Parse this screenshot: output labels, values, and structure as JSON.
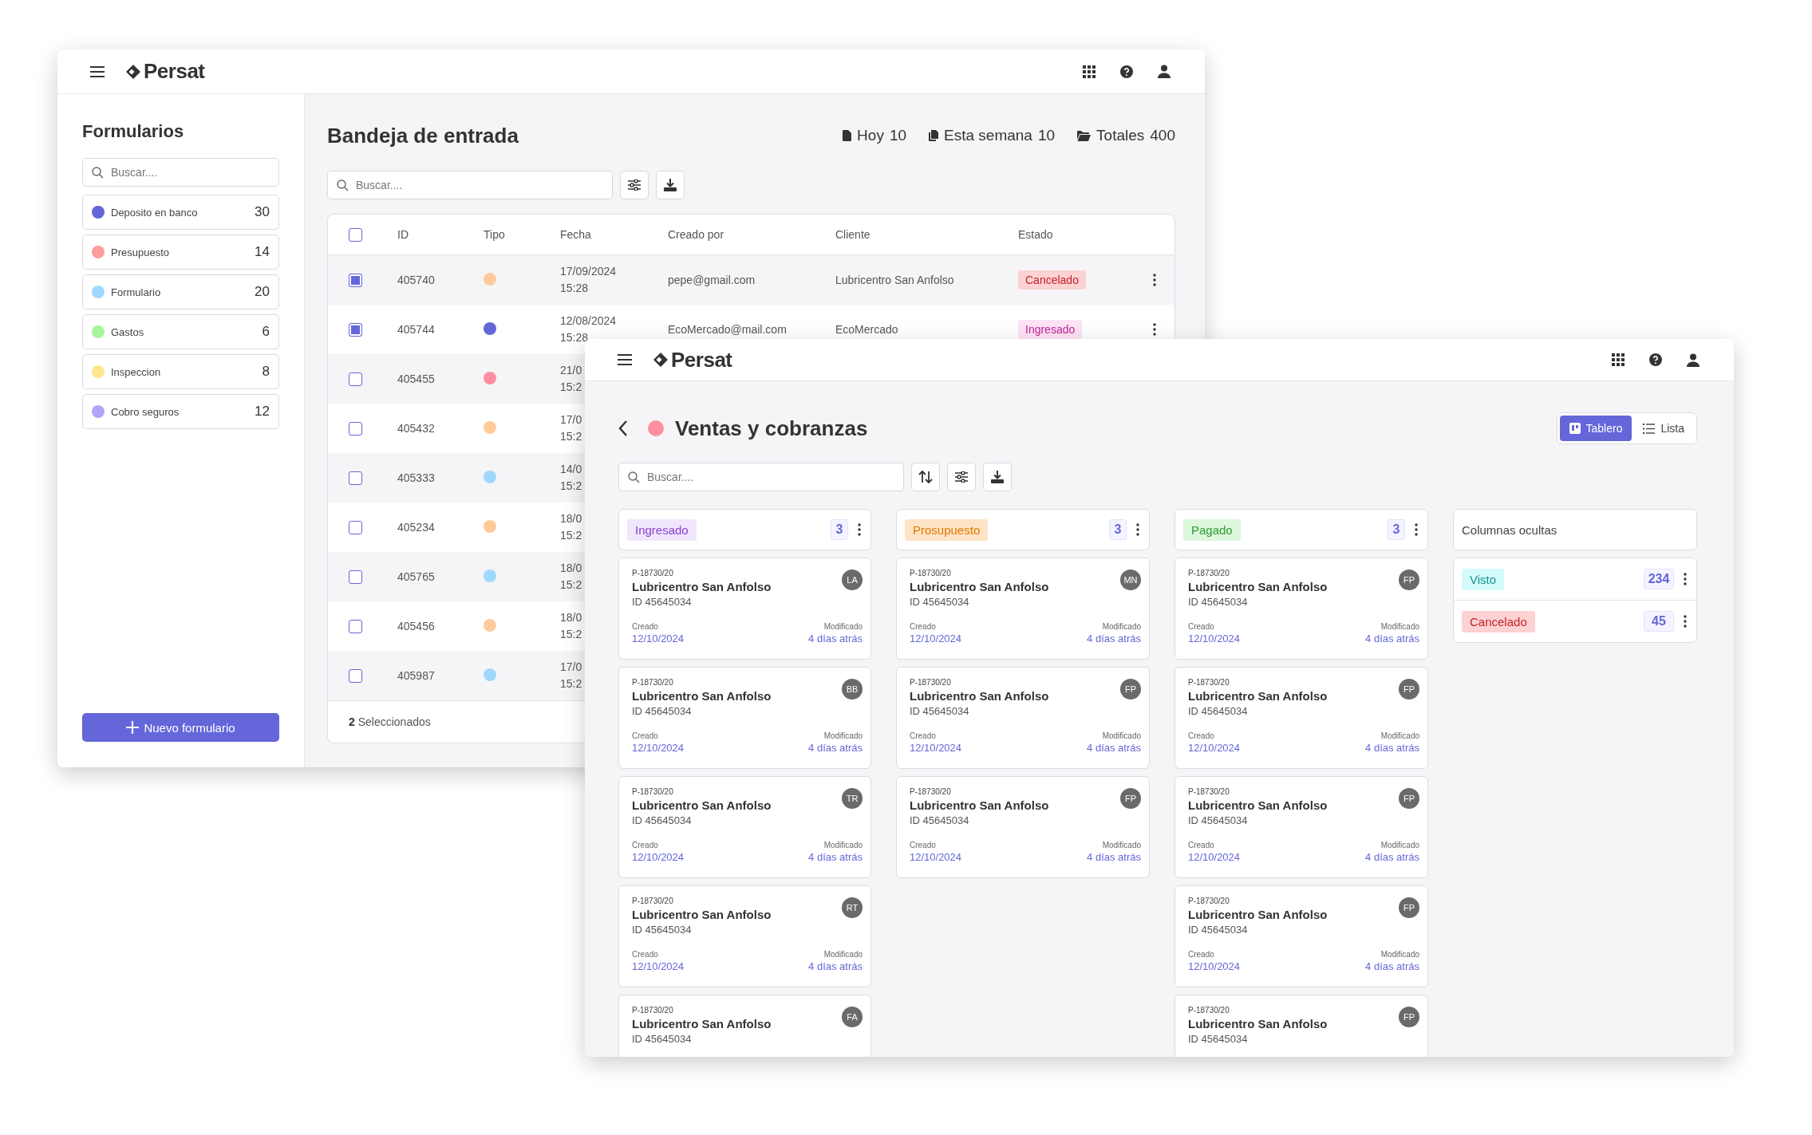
{
  "inbox": {
    "logo": "Persat",
    "sidebar": {
      "title": "Formularios",
      "search": {
        "placeholder": "Buscar...."
      },
      "items": [
        {
          "label": "Deposito en banco",
          "count": "30",
          "color": "#6466d9"
        },
        {
          "label": "Presupuesto",
          "count": "14",
          "color": "#ff9b9b"
        },
        {
          "label": "Formulario",
          "count": "20",
          "color": "#9fd8ff"
        },
        {
          "label": "Gastos",
          "count": "6",
          "color": "#a6f59b"
        },
        {
          "label": "Inspeccion",
          "count": "8",
          "color": "#ffe590"
        },
        {
          "label": "Cobro seguros",
          "count": "12",
          "color": "#b5a3f8"
        }
      ],
      "button": "Nuevo formulario"
    },
    "main": {
      "title": "Bandeja de entrada",
      "stats": [
        {
          "kind": "file",
          "label": "Hoy",
          "value": "10"
        },
        {
          "kind": "files",
          "label": "Esta semana",
          "value": "10"
        },
        {
          "kind": "folder",
          "label": "Totales",
          "value": "400"
        }
      ],
      "search": {
        "placeholder": "Buscar...."
      },
      "table": {
        "header_checked": false,
        "columns": [
          "ID",
          "Tipo",
          "Fecha",
          "Creado por",
          "Cliente",
          "Estado"
        ],
        "rows": [
          {
            "checked": true,
            "id": "405740",
            "color": "#ffcb9a",
            "date": "17/09/2024",
            "time": "15:28",
            "created_by": "pepe@gmail.com",
            "client": "Lubricentro San Anfolso",
            "status": {
              "label": "Cancelado",
              "kind": "cancelado"
            }
          },
          {
            "checked": true,
            "id": "405744",
            "color": "#6466d9",
            "date": "12/08/2024",
            "time": "15:28",
            "created_by": "EcoMercado@mail.com",
            "client": "EcoMercado",
            "status": {
              "label": "Ingresado",
              "kind": "ingresado"
            }
          },
          {
            "checked": false,
            "id": "405455",
            "color": "#ff8ea3",
            "date": "21/0",
            "time": "15:2"
          },
          {
            "checked": false,
            "id": "405432",
            "color": "#ffcb9a",
            "date": "17/0",
            "time": "15:2"
          },
          {
            "checked": false,
            "id": "405333",
            "color": "#9fd8ff",
            "date": "14/0",
            "time": "15:2"
          },
          {
            "checked": false,
            "id": "405234",
            "color": "#ffcb9a",
            "date": "18/0",
            "time": "15:2"
          },
          {
            "checked": false,
            "id": "405765",
            "color": "#9fd8ff",
            "date": "18/0",
            "time": "15:2"
          },
          {
            "checked": false,
            "id": "405456",
            "color": "#ffcb9a",
            "date": "18/0",
            "time": "15:2"
          },
          {
            "checked": false,
            "id": "405987",
            "color": "#9fd8ff",
            "date": "17/0",
            "time": "15:2"
          }
        ],
        "footer": "**2** Seleccionados"
      }
    }
  },
  "board": {
    "logo": "Persat",
    "title": "Ventas y cobranzas",
    "color": "#ff8ea3",
    "views": [
      {
        "kind": "board",
        "label": "Tablero",
        "selected": true
      },
      {
        "kind": "list",
        "label": "Lista",
        "selected": false
      }
    ],
    "search": {
      "placeholder": "Buscar...."
    },
    "columns": [
      {
        "label": "Ingresado",
        "kind": "ingresado",
        "count": "3",
        "cards": [
          {
            "code": "P-18730/20",
            "name": "Lubricentro San Anfolso",
            "id": "ID 45645034",
            "avatar": "LA",
            "created_label": "Creado",
            "created": "12/10/2024",
            "modified_label": "Modificado",
            "modified": "4 días atrás"
          },
          {
            "code": "P-18730/20",
            "name": "Lubricentro San Anfolso",
            "id": "ID 45645034",
            "avatar": "BB",
            "created_label": "Creado",
            "created": "12/10/2024",
            "modified_label": "Modificado",
            "modified": "4 días atrás"
          },
          {
            "code": "P-18730/20",
            "name": "Lubricentro San Anfolso",
            "id": "ID 45645034",
            "avatar": "TR",
            "created_label": "Creado",
            "created": "12/10/2024",
            "modified_label": "Modificado",
            "modified": "4 días atrás"
          },
          {
            "code": "P-18730/20",
            "name": "Lubricentro San Anfolso",
            "id": "ID 45645034",
            "avatar": "RT",
            "created_label": "Creado",
            "created": "12/10/2024",
            "modified_label": "Modificado",
            "modified": "4 días atrás"
          },
          {
            "code": "P-18730/20",
            "name": "Lubricentro San Anfolso",
            "id": "ID 45645034",
            "avatar": "FA"
          }
        ]
      },
      {
        "label": "Prosupuesto",
        "kind": "presupuesto",
        "count": "3",
        "cards": [
          {
            "code": "P-18730/20",
            "name": "Lubricentro San Anfolso",
            "id": "ID 45645034",
            "avatar": "MN",
            "created_label": "Creado",
            "created": "12/10/2024",
            "modified_label": "Modificado",
            "modified": "4 días atrás"
          },
          {
            "code": "P-18730/20",
            "name": "Lubricentro San Anfolso",
            "id": "ID 45645034",
            "avatar": "FP",
            "created_label": "Creado",
            "created": "12/10/2024",
            "modified_label": "Modificado",
            "modified": "4 días atrás"
          },
          {
            "code": "P-18730/20",
            "name": "Lubricentro San Anfolso",
            "id": "ID 45645034",
            "avatar": "FP",
            "created_label": "Creado",
            "created": "12/10/2024",
            "modified_label": "Modificado",
            "modified": "4 días atrás"
          }
        ]
      },
      {
        "label": "Pagado",
        "kind": "pagado",
        "count": "3",
        "cards": [
          {
            "code": "P-18730/20",
            "name": "Lubricentro San Anfolso",
            "id": "ID 45645034",
            "avatar": "FP",
            "created_label": "Creado",
            "created": "12/10/2024",
            "modified_label": "Modificado",
            "modified": "4 días atrás"
          },
          {
            "code": "P-18730/20",
            "name": "Lubricentro San Anfolso",
            "id": "ID 45645034",
            "avatar": "FP",
            "created_label": "Creado",
            "created": "12/10/2024",
            "modified_label": "Modificado",
            "modified": "4 días atrás"
          },
          {
            "code": "P-18730/20",
            "name": "Lubricentro San Anfolso",
            "id": "ID 45645034",
            "avatar": "FP",
            "created_label": "Creado",
            "created": "12/10/2024",
            "modified_label": "Modificado",
            "modified": "4 días atrás"
          },
          {
            "code": "P-18730/20",
            "name": "Lubricentro San Anfolso",
            "id": "ID 45645034",
            "avatar": "FP",
            "created_label": "Creado",
            "created": "12/10/2024",
            "modified_label": "Modificado",
            "modified": "4 días atrás"
          },
          {
            "code": "P-18730/20",
            "name": "Lubricentro San Anfolso",
            "id": "ID 45645034",
            "avatar": "FP"
          }
        ]
      }
    ],
    "hidden": {
      "title": "Columnas ocultas",
      "items": [
        {
          "label": "Visto",
          "kind": "visto",
          "count": "234"
        },
        {
          "label": "Cancelado",
          "kind": "cancelado",
          "count": "45"
        }
      ]
    }
  }
}
